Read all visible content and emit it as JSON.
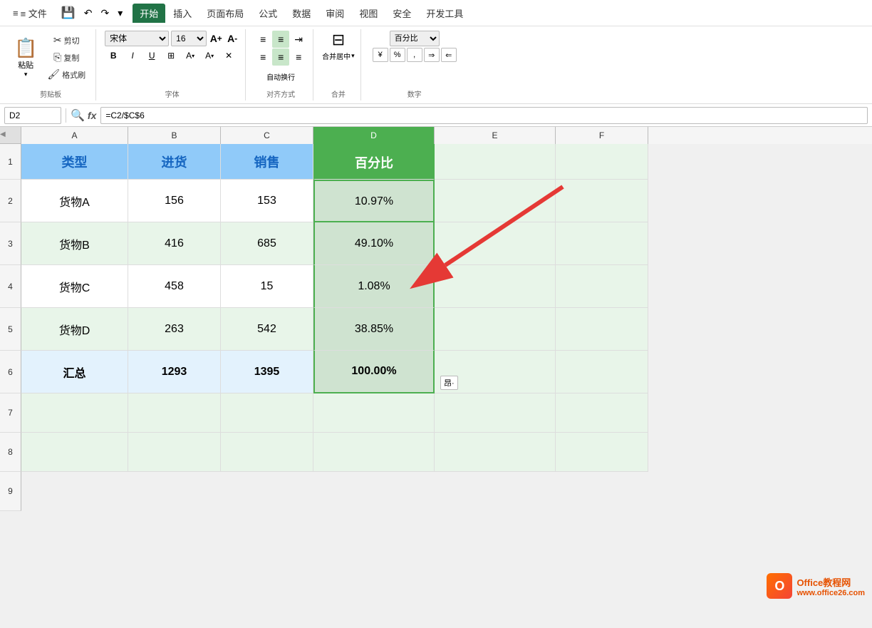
{
  "ribbon": {
    "tabs": [
      "文件",
      "开始",
      "插入",
      "页面布局",
      "公式",
      "数据",
      "审阅",
      "视图",
      "安全",
      "开发工具"
    ],
    "active_tab": "开始",
    "file_menu": "≡ 文件",
    "paste_label": "粘贴",
    "cut_label": "剪切",
    "copy_label": "复制",
    "format_painter_label": "格式刷",
    "font_name": "宋体",
    "font_size": "16",
    "font_size_increase": "A+",
    "font_size_decrease": "A-",
    "bold": "B",
    "italic": "I",
    "underline": "U",
    "border_btn": "⊞",
    "fill_color": "▲",
    "font_color": "A",
    "clear": "✕",
    "align_top": "⊤",
    "align_mid": "⊥",
    "align_bottom": "⊥",
    "align_left": "≡",
    "align_center": "≡",
    "align_right": "≡",
    "wrap_text": "自动换行",
    "merge_center": "合并居中",
    "number_format": "百分比",
    "percent_btn": "%",
    "comma_btn": ","
  },
  "formula_bar": {
    "cell_ref": "D2",
    "formula": "=C2/$C$6"
  },
  "columns": {
    "corner": "",
    "headers": [
      "A",
      "B",
      "C",
      "D",
      "E",
      "F"
    ]
  },
  "rows": {
    "headers": [
      "1",
      "2",
      "3",
      "4",
      "5",
      "6",
      "7",
      "8",
      "9"
    ]
  },
  "table": {
    "headers": [
      "类型",
      "进货",
      "销售",
      "百分比"
    ],
    "data": [
      {
        "type": "货物A",
        "purchase": "156",
        "sales": "153",
        "percent": "10.97%"
      },
      {
        "type": "货物B",
        "purchase": "416",
        "sales": "685",
        "percent": "49.10%"
      },
      {
        "type": "货物C",
        "purchase": "458",
        "sales": "15",
        "percent": "1.08%"
      },
      {
        "type": "货物D",
        "purchase": "263",
        "sales": "542",
        "percent": "38.85%"
      },
      {
        "type": "汇总",
        "purchase": "1293",
        "sales": "1395",
        "percent": "100.00%"
      }
    ]
  },
  "watermark": {
    "site": "Office教程网",
    "url": "www.office26.com",
    "icon": "O"
  },
  "autofill": "昂·",
  "colors": {
    "header_bg": "#90caf9",
    "header_text": "#1565c0",
    "odd_row_bg": "#ffffff",
    "even_row_bg": "#e8f5e9",
    "summary_bg": "#e3f2fd",
    "selected_col_bg": "#c8e6c9",
    "active_border": "#4caf50",
    "sheet_bg": "#e8f5e9"
  }
}
